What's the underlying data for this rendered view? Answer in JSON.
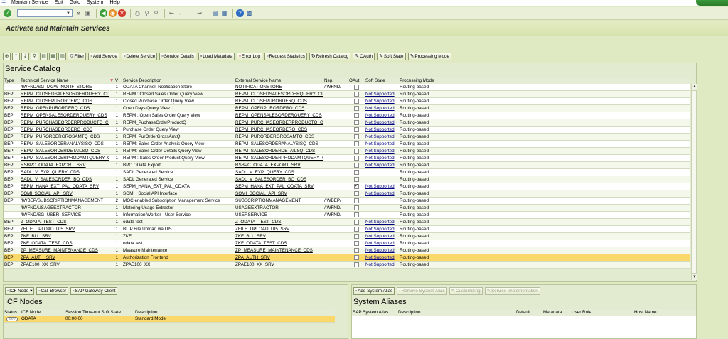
{
  "menu": {
    "items": [
      "Maintain Service",
      "Edit",
      "Goto",
      "System",
      "Help"
    ]
  },
  "toolbar": {
    "back_glyph": "«"
  },
  "title": "Activate and Maintain Services",
  "app_toolbar": {
    "buttons": [
      "Filter",
      "Add Service",
      "Delete Service",
      "Service Details",
      "Load Metadata",
      "Error Log",
      "Request Statistics",
      "Refresh Catalog",
      "OAuth",
      "Soft State",
      "Processing Mode"
    ]
  },
  "catalog": {
    "title": "Service Catalog",
    "columns": [
      "Type",
      "Technical Service Name",
      "V",
      "Service Description",
      "External Service Name",
      "Nsp.",
      "OAut",
      "Soft State",
      "Processing Mode"
    ],
    "rows": [
      {
        "type": "",
        "name": "/IWFND/SG_MGW_NOTIF_STORE",
        "ver": "1",
        "desc": "ODATA Channel: Notification Store",
        "ext": "NOTIFICATIONSTORE",
        "nsp": "/IWFND/",
        "oauth": false,
        "soft": "",
        "proc": "Routing-based"
      },
      {
        "type": "BEP",
        "name": "REPM_CLOSEDSALESORDERQUERY_CDS",
        "ver": "1",
        "desc": "REPM : Closed Sales Order Query View",
        "ext": "REPM_CLOSEDSALESORDERQUERY_CDS",
        "nsp": "",
        "oauth": false,
        "soft": "Not Supported",
        "proc": "Routing-based"
      },
      {
        "type": "BEP",
        "name": "REPM_CLOSEPURORDERQ_CDS",
        "ver": "1",
        "desc": "Closed Purchase Order Query View",
        "ext": "REPM_CLOSEPURORDERQ_CDS",
        "nsp": "",
        "oauth": false,
        "soft": "Not Supported",
        "proc": "Routing-based"
      },
      {
        "type": "BEP",
        "name": "REPM_OPENPURORDERQ_CDS",
        "ver": "1",
        "desc": "Open Days Query View",
        "ext": "REPM_OPENPURORDERQ_CDS",
        "nsp": "",
        "oauth": false,
        "soft": "Not Supported",
        "proc": "Routing-based"
      },
      {
        "type": "BEP",
        "name": "REPM_OPENSALESORDERQUERY_CDS",
        "ver": "1",
        "desc": "REPM : Open Sales Order Query View",
        "ext": "REPM_OPENSALESORDERQUERY_CDS",
        "nsp": "",
        "oauth": false,
        "soft": "Not Supported",
        "proc": "Routing-based"
      },
      {
        "type": "BEP",
        "name": "REPM_PURCHASEORDERPRODUCTQ_CDS",
        "ver": "1",
        "desc": "REPM_PuchaseOrderProductQ",
        "ext": "REPM_PURCHASEORDERPRODUCTQ_CDS",
        "nsp": "",
        "oauth": false,
        "soft": "Not Supported",
        "proc": "Routing-based"
      },
      {
        "type": "BEP",
        "name": "REPM_PURCHASEORDERQ_CDS",
        "ver": "1",
        "desc": "Purchase Order Query View",
        "ext": "REPM_PURCHASEORDERQ_CDS",
        "nsp": "",
        "oauth": false,
        "soft": "Not Supported",
        "proc": "Routing-based"
      },
      {
        "type": "BEP",
        "name": "REPM_PURORDERGROSAMTQ_CDS",
        "ver": "1",
        "desc": "REPM_PurOrderGrossAmtQ",
        "ext": "REPM_PURORDERGROSAMTQ_CDS",
        "nsp": "",
        "oauth": false,
        "soft": "Not Supported",
        "proc": "Routing-based"
      },
      {
        "type": "BEP",
        "name": "REPM_SALESORDERANALYSISQ_CDS",
        "ver": "1",
        "desc": "REPM: Sales Order Analysis Query View",
        "ext": "REPM_SALESORDERANALYSISQ_CDS",
        "nsp": "",
        "oauth": false,
        "soft": "Not Supported",
        "proc": "Routing-based"
      },
      {
        "type": "BEP",
        "name": "REPM_SALESORDERDETAILSQ_CDS",
        "ver": "1",
        "desc": "REPM: Sales Order Details Query View",
        "ext": "REPM_SALESORDERDETAILSQ_CDS",
        "nsp": "",
        "oauth": false,
        "soft": "Not Supported",
        "proc": "Routing-based"
      },
      {
        "type": "BEP",
        "name": "REPM_SALESORDERPRODAMTQUERY_CDS",
        "ver": "1",
        "desc": "REPM : Sales Order Product Query View",
        "ext": "REPM_SALESORDERPRODAMTQUERY_CDS",
        "nsp": "",
        "oauth": false,
        "soft": "Not Supported",
        "proc": "Routing-based"
      },
      {
        "type": "BEP",
        "name": "RSBPC_ODATA_EXPORT_SRV",
        "ver": "1",
        "desc": "BPC OData Export",
        "ext": "RSBPC_ODATA_EXPORT_SRV",
        "nsp": "",
        "oauth": false,
        "soft": "Not Supported",
        "proc": "Routing-based"
      },
      {
        "type": "BEP",
        "name": "SADL_V_EXP_QUERY_CDS",
        "ver": "1",
        "desc": "SADL Generated Service",
        "ext": "SADL_V_EXP_QUERY_CDS",
        "nsp": "",
        "oauth": false,
        "soft": "",
        "proc": "Routing-based"
      },
      {
        "type": "BEP",
        "name": "SADL_V_SALESORDER_BO_CDS",
        "ver": "1",
        "desc": "SADL Generated Service",
        "ext": "SADL_V_SALESORDER_BO_CDS",
        "nsp": "",
        "oauth": false,
        "soft": "",
        "proc": "Routing-based"
      },
      {
        "type": "BEP",
        "name": "SEPM_HANA_EXT_PAL_ODATA_SRV",
        "ver": "1",
        "desc": "SEPM_HANA_EXT_PAL_ODATA",
        "ext": "SEPM_HANA_EXT_PAL_ODATA_SRV",
        "nsp": "",
        "oauth": true,
        "soft": "Not Supported",
        "proc": "Routing-based"
      },
      {
        "type": "BEP",
        "name": "SOMI_SOCIAL_API_SRV",
        "ver": "1",
        "desc": "SOMI : Social API Interface",
        "ext": "SOMI_SOCIAL_API_SRV",
        "nsp": "",
        "oauth": false,
        "soft": "Not Supported",
        "proc": "Routing-based"
      },
      {
        "type": "BEP",
        "name": "/IWBEP/SUBSCRIPTIONMANAGEMENT",
        "ver": "2",
        "desc": "MOC enabled Subscription Management Service",
        "ext": "SUBSCRIPTIONMANAGEMENT",
        "nsp": "/IWBEP/",
        "oauth": false,
        "soft": "",
        "proc": "Routing-based"
      },
      {
        "type": "",
        "name": "/IWFND/USAGEEXTRACTOR",
        "ver": "1",
        "desc": "Metering Usage Extractor",
        "ext": "USAGEEXTRACTOR",
        "nsp": "/IWFND/",
        "oauth": false,
        "soft": "",
        "proc": "Routing-based"
      },
      {
        "type": "",
        "name": "/IWFND/SG_USER_SERVICE",
        "ver": "1",
        "desc": "Information Worker - User Service",
        "ext": "USERSERVICE",
        "nsp": "/IWFND/",
        "oauth": false,
        "soft": "",
        "proc": "Routing-based"
      },
      {
        "type": "BEP",
        "name": "Z_ODATA_TEST_CDS",
        "ver": "1",
        "desc": "odata test",
        "ext": "Z_ODATA_TEST_CDS",
        "nsp": "",
        "oauth": false,
        "soft": "Not Supported",
        "proc": "Routing-based"
      },
      {
        "type": "BEP",
        "name": "ZFILE_UPLOAD_UI5_SRV",
        "ver": "1",
        "desc": "BI IP File Upload via UI5",
        "ext": "ZFILE_UPLOAD_UI5_SRV",
        "nsp": "",
        "oauth": false,
        "soft": "Not Supported",
        "proc": "Routing-based"
      },
      {
        "type": "BEP",
        "name": "ZKF_BLL_SRV",
        "ver": "1",
        "desc": "ZKF",
        "ext": "ZKF_BLL_SRV",
        "nsp": "",
        "oauth": false,
        "soft": "Not Supported",
        "proc": "Routing-based"
      },
      {
        "type": "BEP",
        "name": "ZKF_ODATA_TEST_CDS",
        "ver": "1",
        "desc": "odata test",
        "ext": "ZKF_ODATA_TEST_CDS",
        "nsp": "",
        "oauth": false,
        "soft": "Not Supported",
        "proc": "Routing-based"
      },
      {
        "type": "BEP",
        "name": "ZP_MEASURE_MAINTENANCE_CDS",
        "ver": "1",
        "desc": "Measure Maintenance",
        "ext": "ZP_MEASURE_MAINTENANCE_CDS",
        "nsp": "",
        "oauth": false,
        "soft": "Not Supported",
        "proc": "Routing-based"
      },
      {
        "type": "BEP",
        "name": "ZPA_AUTH_SRV",
        "ver": "1",
        "desc": "Authorization Frontend",
        "ext": "ZPA_AUTH_SRV",
        "nsp": "",
        "oauth": false,
        "soft": "Not Supported",
        "proc": "Routing-based",
        "selected": true
      },
      {
        "type": "BEP",
        "name": "ZPAE100_XX_SRV",
        "ver": "1",
        "desc": "ZPAE100_XX",
        "ext": "ZPAE100_XX_SRV",
        "nsp": "",
        "oauth": false,
        "soft": "Not Supported",
        "proc": "Routing-based"
      }
    ]
  },
  "icf": {
    "buttons": [
      "ICF Node",
      "Call Browser",
      "SAP Gateway Client"
    ],
    "title": "ICF Nodes",
    "columns": [
      "Status",
      "ICF Node",
      "Session Time-out",
      "Soft State",
      "Description"
    ],
    "rows": [
      {
        "status": "○○○",
        "node": "ODATA",
        "timeout": "00:00:00",
        "soft": "",
        "desc": "Standard Mode"
      }
    ]
  },
  "aliases": {
    "buttons": [
      "Add System Alias",
      "Remove System Alias",
      "Customizing",
      "Service Implementation"
    ],
    "title": "System Aliases",
    "columns": [
      "SAP System Alias",
      "Description",
      "Default",
      "Metadata",
      "User Role",
      "Host Name"
    ]
  }
}
